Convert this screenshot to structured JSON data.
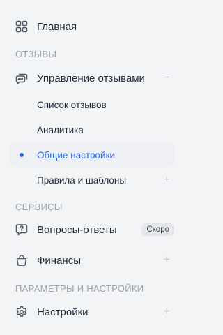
{
  "nav": {
    "home": {
      "label": "Главная",
      "icon": "grid-icon"
    },
    "reviews_section": {
      "title": "ОТЗЫВЫ"
    },
    "reviews": {
      "label": "Управление отзывами",
      "icon": "chat-bubbles-icon",
      "toggle": "−",
      "subitems": [
        {
          "label": "Список отзывов"
        },
        {
          "label": "Аналитика"
        },
        {
          "label": "Общие настройки",
          "active": true
        },
        {
          "label": "Правила и шаблоны",
          "toggle": "+"
        }
      ]
    },
    "services_section": {
      "title": "СЕРВИСЫ"
    },
    "qa": {
      "label": "Вопросы-ответы",
      "icon": "question-bubble-icon",
      "badge": "Скоро"
    },
    "finance": {
      "label": "Финансы",
      "icon": "bag-icon",
      "toggle": "+"
    },
    "params_section": {
      "title": "ПАРАМЕТРЫ И НАСТРОЙКИ"
    },
    "settings": {
      "label": "Настройки",
      "icon": "gear-icon",
      "toggle": "+"
    }
  },
  "colors": {
    "accent": "#2563eb",
    "muted": "#9ca3af",
    "background": "#f3f4f6",
    "active_bg": "#eef0f3"
  }
}
